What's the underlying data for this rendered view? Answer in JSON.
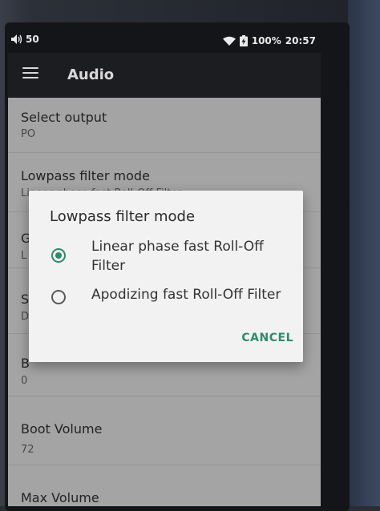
{
  "status_bar": {
    "volume_icon": "volume-icon",
    "volume_level": "50",
    "wifi_icon": "wifi-icon",
    "battery_icon": "battery-charging-icon",
    "battery_percent": "100%",
    "time": "20:57"
  },
  "toolbar": {
    "menu_icon": "hamburger-menu-icon",
    "title": "Audio"
  },
  "settings": {
    "select_output_title": "Select output",
    "select_output_value": "PO",
    "lowpass_title": "Lowpass filter mode",
    "lowpass_value": "Linear phase fast Roll-Off Filter",
    "gain_title_partial": "G",
    "gain_value_partial": "L",
    "s_title_partial": "S",
    "s_value_partial": "D",
    "balance_title_partial": "B",
    "balance_value": "0",
    "boot_volume_title": "Boot Volume",
    "boot_volume_value": "72",
    "max_volume_title": "Max Volume"
  },
  "dialog": {
    "title": "Lowpass filter mode",
    "options": [
      {
        "label_line1": "Linear phase fast Roll-Off",
        "label_line2": "Filter",
        "selected": true
      },
      {
        "label_line1": "Apodizing fast Roll-Off Filter",
        "label_line2": "",
        "selected": false
      }
    ],
    "cancel_label": "CANCEL"
  },
  "colors": {
    "accent": "#2e8b6a",
    "list_bg": "#c9c9c9",
    "toolbar_bg": "#1c1d21",
    "dialog_bg": "#f2f2f2"
  }
}
